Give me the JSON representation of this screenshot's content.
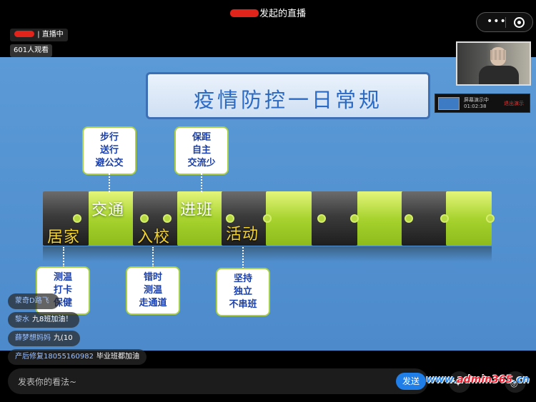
{
  "header": {
    "host_name": "",
    "title_suffix": "发起的直播",
    "more_icon": "more-dots-icon",
    "close_icon": "target-circle-icon"
  },
  "host_badge": {
    "name": "",
    "status": "| 直播中"
  },
  "viewer_count": "601人观看",
  "slide": {
    "title": "疫情防控一日常规",
    "colors": {
      "background": "#5b9ad6",
      "title_text": "#2a6ac4",
      "green_segment": "#a8d32f",
      "dark_segment": "#3b3b3b",
      "dark_label": "#f1d232",
      "card_text": "#1a3fa8"
    },
    "timeline_labels": {
      "home": "居家",
      "traffic": "交通",
      "enter_school": "入校",
      "enter_class": "进班",
      "activity": "活动"
    },
    "cards": {
      "traffic": [
        "步行",
        "送行",
        "避公交"
      ],
      "enter_class": [
        "保距",
        "自主",
        "交流少"
      ],
      "home": [
        "测温",
        "打卡",
        "保健"
      ],
      "enter_school": [
        "错时",
        "测温",
        "走通道"
      ],
      "activity": [
        "坚持",
        "独立",
        "不串班"
      ]
    }
  },
  "recording_window": {
    "status": "屏幕演示中",
    "time": "01:02:38",
    "exit_label": "退出演示"
  },
  "comments": [
    {
      "user": "蒙奇D路飞",
      "text": ""
    },
    {
      "user": "黎水",
      "text": "九8班加油！"
    },
    {
      "user": "薛梦想妈妈",
      "text": "九(10"
    },
    {
      "user": "产后修复18055160982",
      "text": "毕业班都加油"
    }
  ],
  "input": {
    "placeholder": "发表你的看法~",
    "send_label": "发送"
  },
  "watermark": {
    "prefix": "www.",
    "brand": "admin365",
    "suffix": ".cn"
  }
}
